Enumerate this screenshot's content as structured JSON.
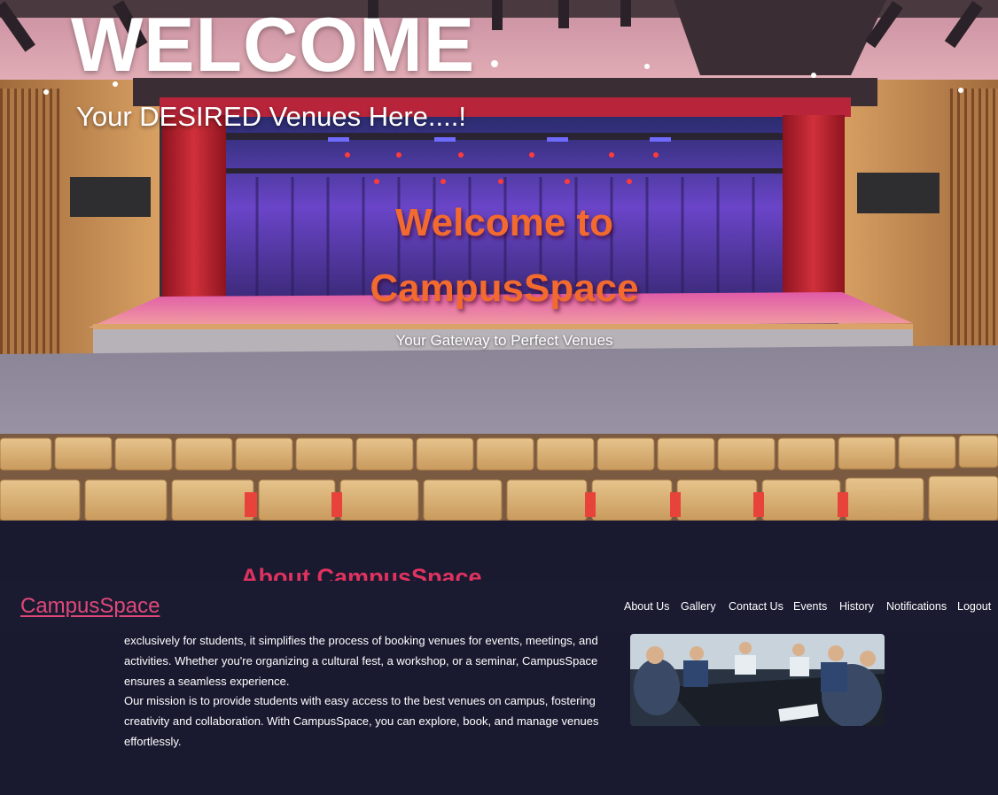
{
  "hero": {
    "welcome": "WELCOME",
    "subtitle": "Your DESIRED Venues Here....!",
    "title_line1": "Welcome to",
    "title_line2": "CampusSpace",
    "tagline": "Your Gateway to Perfect Venues"
  },
  "about": {
    "heading": "About CampusSpace",
    "paragraph1": "exclusively for students, it simplifies the process of booking venues for events, meetings, and activities. Whether you're organizing a cultural fest, a workshop, or a seminar, CampusSpace ensures a seamless experience.",
    "paragraph2": "Our mission is to provide students with easy access to the best venues on campus, fostering creativity and collaboration. With CampusSpace, you can explore, book, and manage venues effortlessly."
  },
  "navbar": {
    "brand": "CampusSpace",
    "links": [
      "About Us",
      "Gallery",
      "Contact Us",
      "Events",
      "History",
      "Notifications",
      "Logout"
    ]
  },
  "colors": {
    "background": "#191a30",
    "brand": "#e0487a",
    "accent_title": "#f26a2e",
    "about_heading": "#e0325f"
  }
}
